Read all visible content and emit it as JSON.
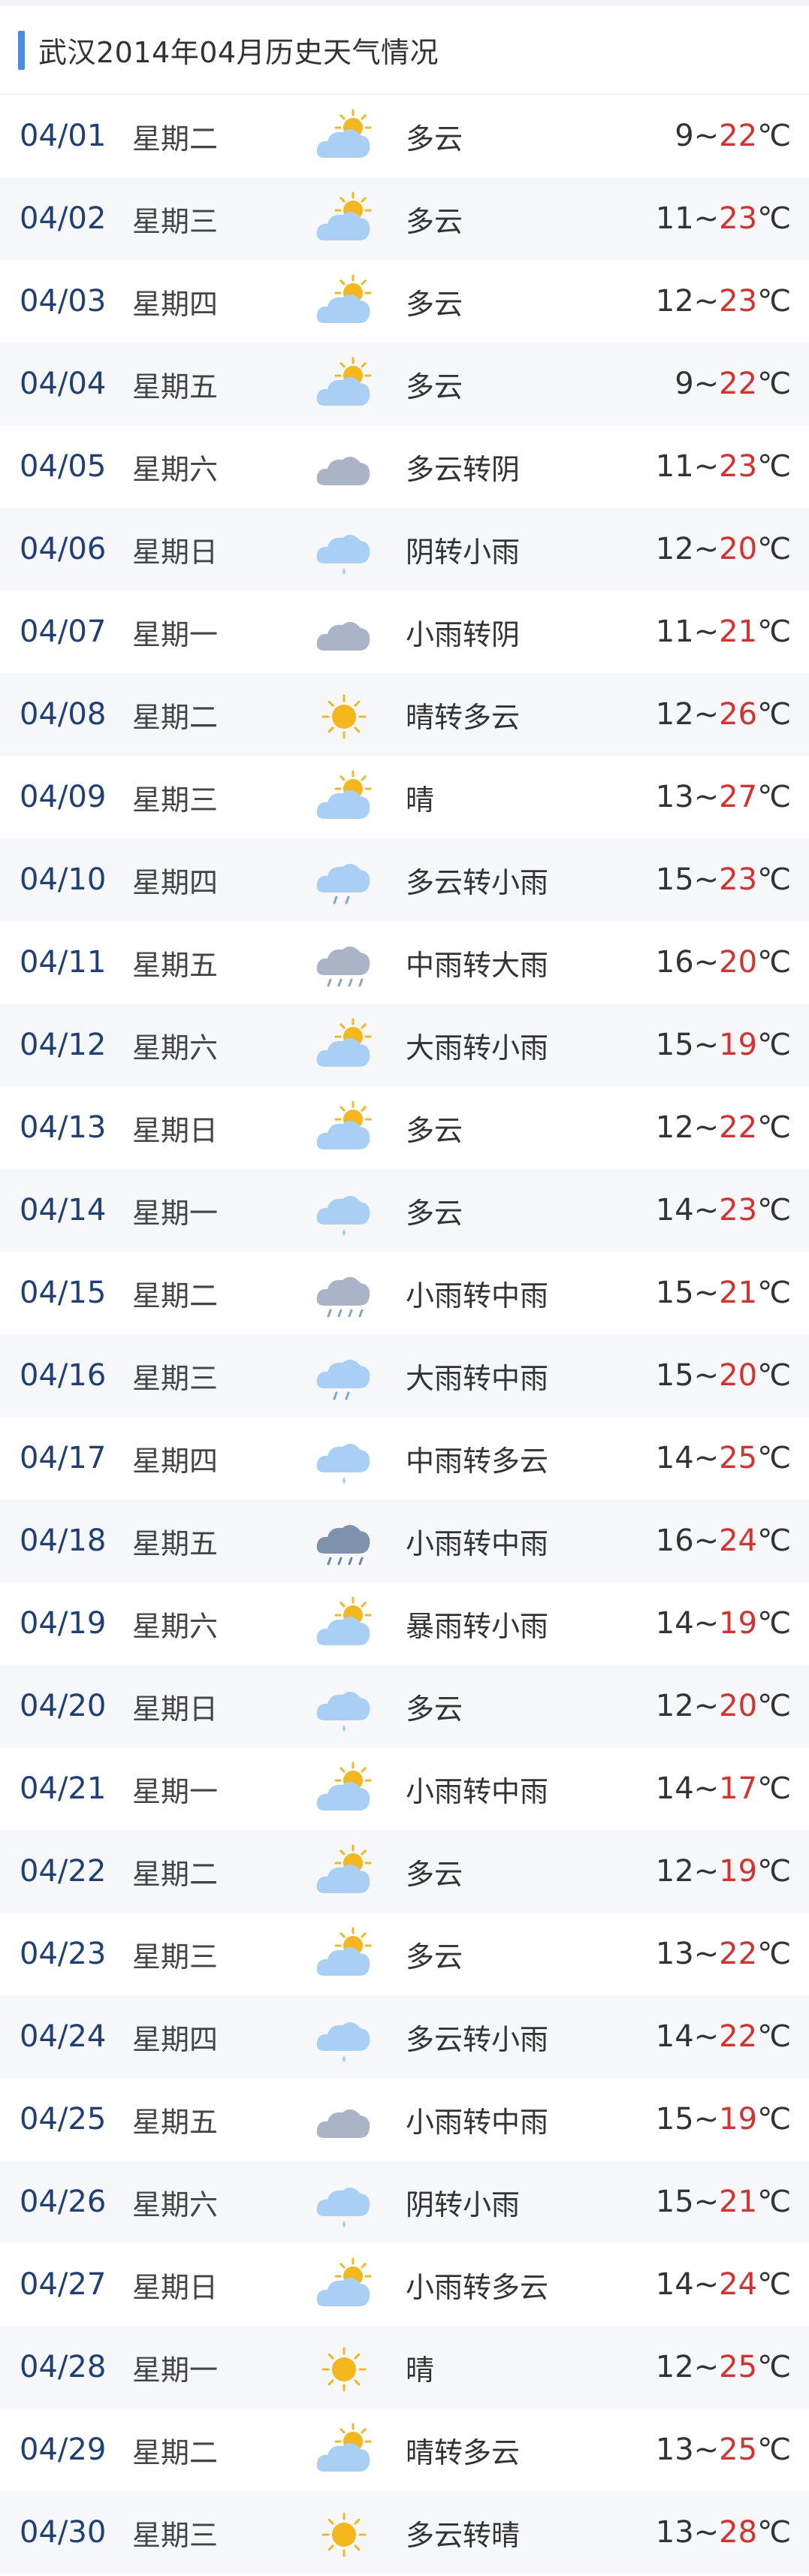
{
  "header": {
    "title": "武汉2014年04月历史天气情况"
  },
  "days": [
    {
      "date": "04/01",
      "weekday": "星期二",
      "icon": "partly-cloudy-icon",
      "weather": "多云",
      "low": "9",
      "high": "22",
      "unit": "℃"
    },
    {
      "date": "04/02",
      "weekday": "星期三",
      "icon": "partly-cloudy-icon",
      "weather": "多云",
      "low": "11",
      "high": "23",
      "unit": "℃"
    },
    {
      "date": "04/03",
      "weekday": "星期四",
      "icon": "partly-cloudy-icon",
      "weather": "多云",
      "low": "12",
      "high": "23",
      "unit": "℃"
    },
    {
      "date": "04/04",
      "weekday": "星期五",
      "icon": "partly-cloudy-icon",
      "weather": "多云",
      "low": "9",
      "high": "22",
      "unit": "℃"
    },
    {
      "date": "04/05",
      "weekday": "星期六",
      "icon": "overcast-icon",
      "weather": "多云转阴",
      "low": "11",
      "high": "23",
      "unit": "℃"
    },
    {
      "date": "04/06",
      "weekday": "星期日",
      "icon": "light-rain-icon",
      "weather": "阴转小雨",
      "low": "12",
      "high": "20",
      "unit": "℃"
    },
    {
      "date": "04/07",
      "weekday": "星期一",
      "icon": "overcast-icon",
      "weather": "小雨转阴",
      "low": "11",
      "high": "21",
      "unit": "℃"
    },
    {
      "date": "04/08",
      "weekday": "星期二",
      "icon": "sunny-icon",
      "weather": "晴转多云",
      "low": "12",
      "high": "26",
      "unit": "℃"
    },
    {
      "date": "04/09",
      "weekday": "星期三",
      "icon": "partly-cloudy-icon",
      "weather": "晴",
      "low": "13",
      "high": "27",
      "unit": "℃"
    },
    {
      "date": "04/10",
      "weekday": "星期四",
      "icon": "moderate-rain-icon",
      "weather": "多云转小雨",
      "low": "15",
      "high": "23",
      "unit": "℃"
    },
    {
      "date": "04/11",
      "weekday": "星期五",
      "icon": "heavy-rain-icon",
      "weather": "中雨转大雨",
      "low": "16",
      "high": "20",
      "unit": "℃"
    },
    {
      "date": "04/12",
      "weekday": "星期六",
      "icon": "partly-cloudy-icon",
      "weather": "大雨转小雨",
      "low": "15",
      "high": "19",
      "unit": "℃"
    },
    {
      "date": "04/13",
      "weekday": "星期日",
      "icon": "partly-cloudy-icon",
      "weather": "多云",
      "low": "12",
      "high": "22",
      "unit": "℃"
    },
    {
      "date": "04/14",
      "weekday": "星期一",
      "icon": "light-rain-icon",
      "weather": "多云",
      "low": "14",
      "high": "23",
      "unit": "℃"
    },
    {
      "date": "04/15",
      "weekday": "星期二",
      "icon": "heavy-rain-icon",
      "weather": "小雨转中雨",
      "low": "15",
      "high": "21",
      "unit": "℃"
    },
    {
      "date": "04/16",
      "weekday": "星期三",
      "icon": "moderate-rain-icon",
      "weather": "大雨转中雨",
      "low": "15",
      "high": "20",
      "unit": "℃"
    },
    {
      "date": "04/17",
      "weekday": "星期四",
      "icon": "light-rain-icon",
      "weather": "中雨转多云",
      "low": "14",
      "high": "25",
      "unit": "℃"
    },
    {
      "date": "04/18",
      "weekday": "星期五",
      "icon": "storm-rain-icon",
      "weather": "小雨转中雨",
      "low": "16",
      "high": "24",
      "unit": "℃"
    },
    {
      "date": "04/19",
      "weekday": "星期六",
      "icon": "partly-cloudy-icon",
      "weather": "暴雨转小雨",
      "low": "14",
      "high": "19",
      "unit": "℃"
    },
    {
      "date": "04/20",
      "weekday": "星期日",
      "icon": "light-rain-icon",
      "weather": "多云",
      "low": "12",
      "high": "20",
      "unit": "℃"
    },
    {
      "date": "04/21",
      "weekday": "星期一",
      "icon": "partly-cloudy-icon",
      "weather": "小雨转中雨",
      "low": "14",
      "high": "17",
      "unit": "℃"
    },
    {
      "date": "04/22",
      "weekday": "星期二",
      "icon": "partly-cloudy-icon",
      "weather": "多云",
      "low": "12",
      "high": "19",
      "unit": "℃"
    },
    {
      "date": "04/23",
      "weekday": "星期三",
      "icon": "partly-cloudy-icon",
      "weather": "多云",
      "low": "13",
      "high": "22",
      "unit": "℃"
    },
    {
      "date": "04/24",
      "weekday": "星期四",
      "icon": "light-rain-icon",
      "weather": "多云转小雨",
      "low": "14",
      "high": "22",
      "unit": "℃"
    },
    {
      "date": "04/25",
      "weekday": "星期五",
      "icon": "overcast-icon",
      "weather": "小雨转中雨",
      "low": "15",
      "high": "19",
      "unit": "℃"
    },
    {
      "date": "04/26",
      "weekday": "星期六",
      "icon": "light-rain-icon",
      "weather": "阴转小雨",
      "low": "15",
      "high": "21",
      "unit": "℃"
    },
    {
      "date": "04/27",
      "weekday": "星期日",
      "icon": "partly-cloudy-icon",
      "weather": "小雨转多云",
      "low": "14",
      "high": "24",
      "unit": "℃"
    },
    {
      "date": "04/28",
      "weekday": "星期一",
      "icon": "sunny-icon",
      "weather": "晴",
      "low": "12",
      "high": "25",
      "unit": "℃"
    },
    {
      "date": "04/29",
      "weekday": "星期二",
      "icon": "partly-cloudy-icon",
      "weather": "晴转多云",
      "low": "13",
      "high": "25",
      "unit": "℃"
    },
    {
      "date": "04/30",
      "weekday": "星期三",
      "icon": "sunny-icon",
      "weather": "多云转晴",
      "low": "13",
      "high": "28",
      "unit": "℃"
    }
  ],
  "colors": {
    "accent": "#4a8be8",
    "date": "#1f3f7a",
    "high_temp": "#d9302d",
    "cloud_light": "#a9cff5",
    "cloud_gray": "#aab4c6",
    "sun": "#f5b81c"
  }
}
